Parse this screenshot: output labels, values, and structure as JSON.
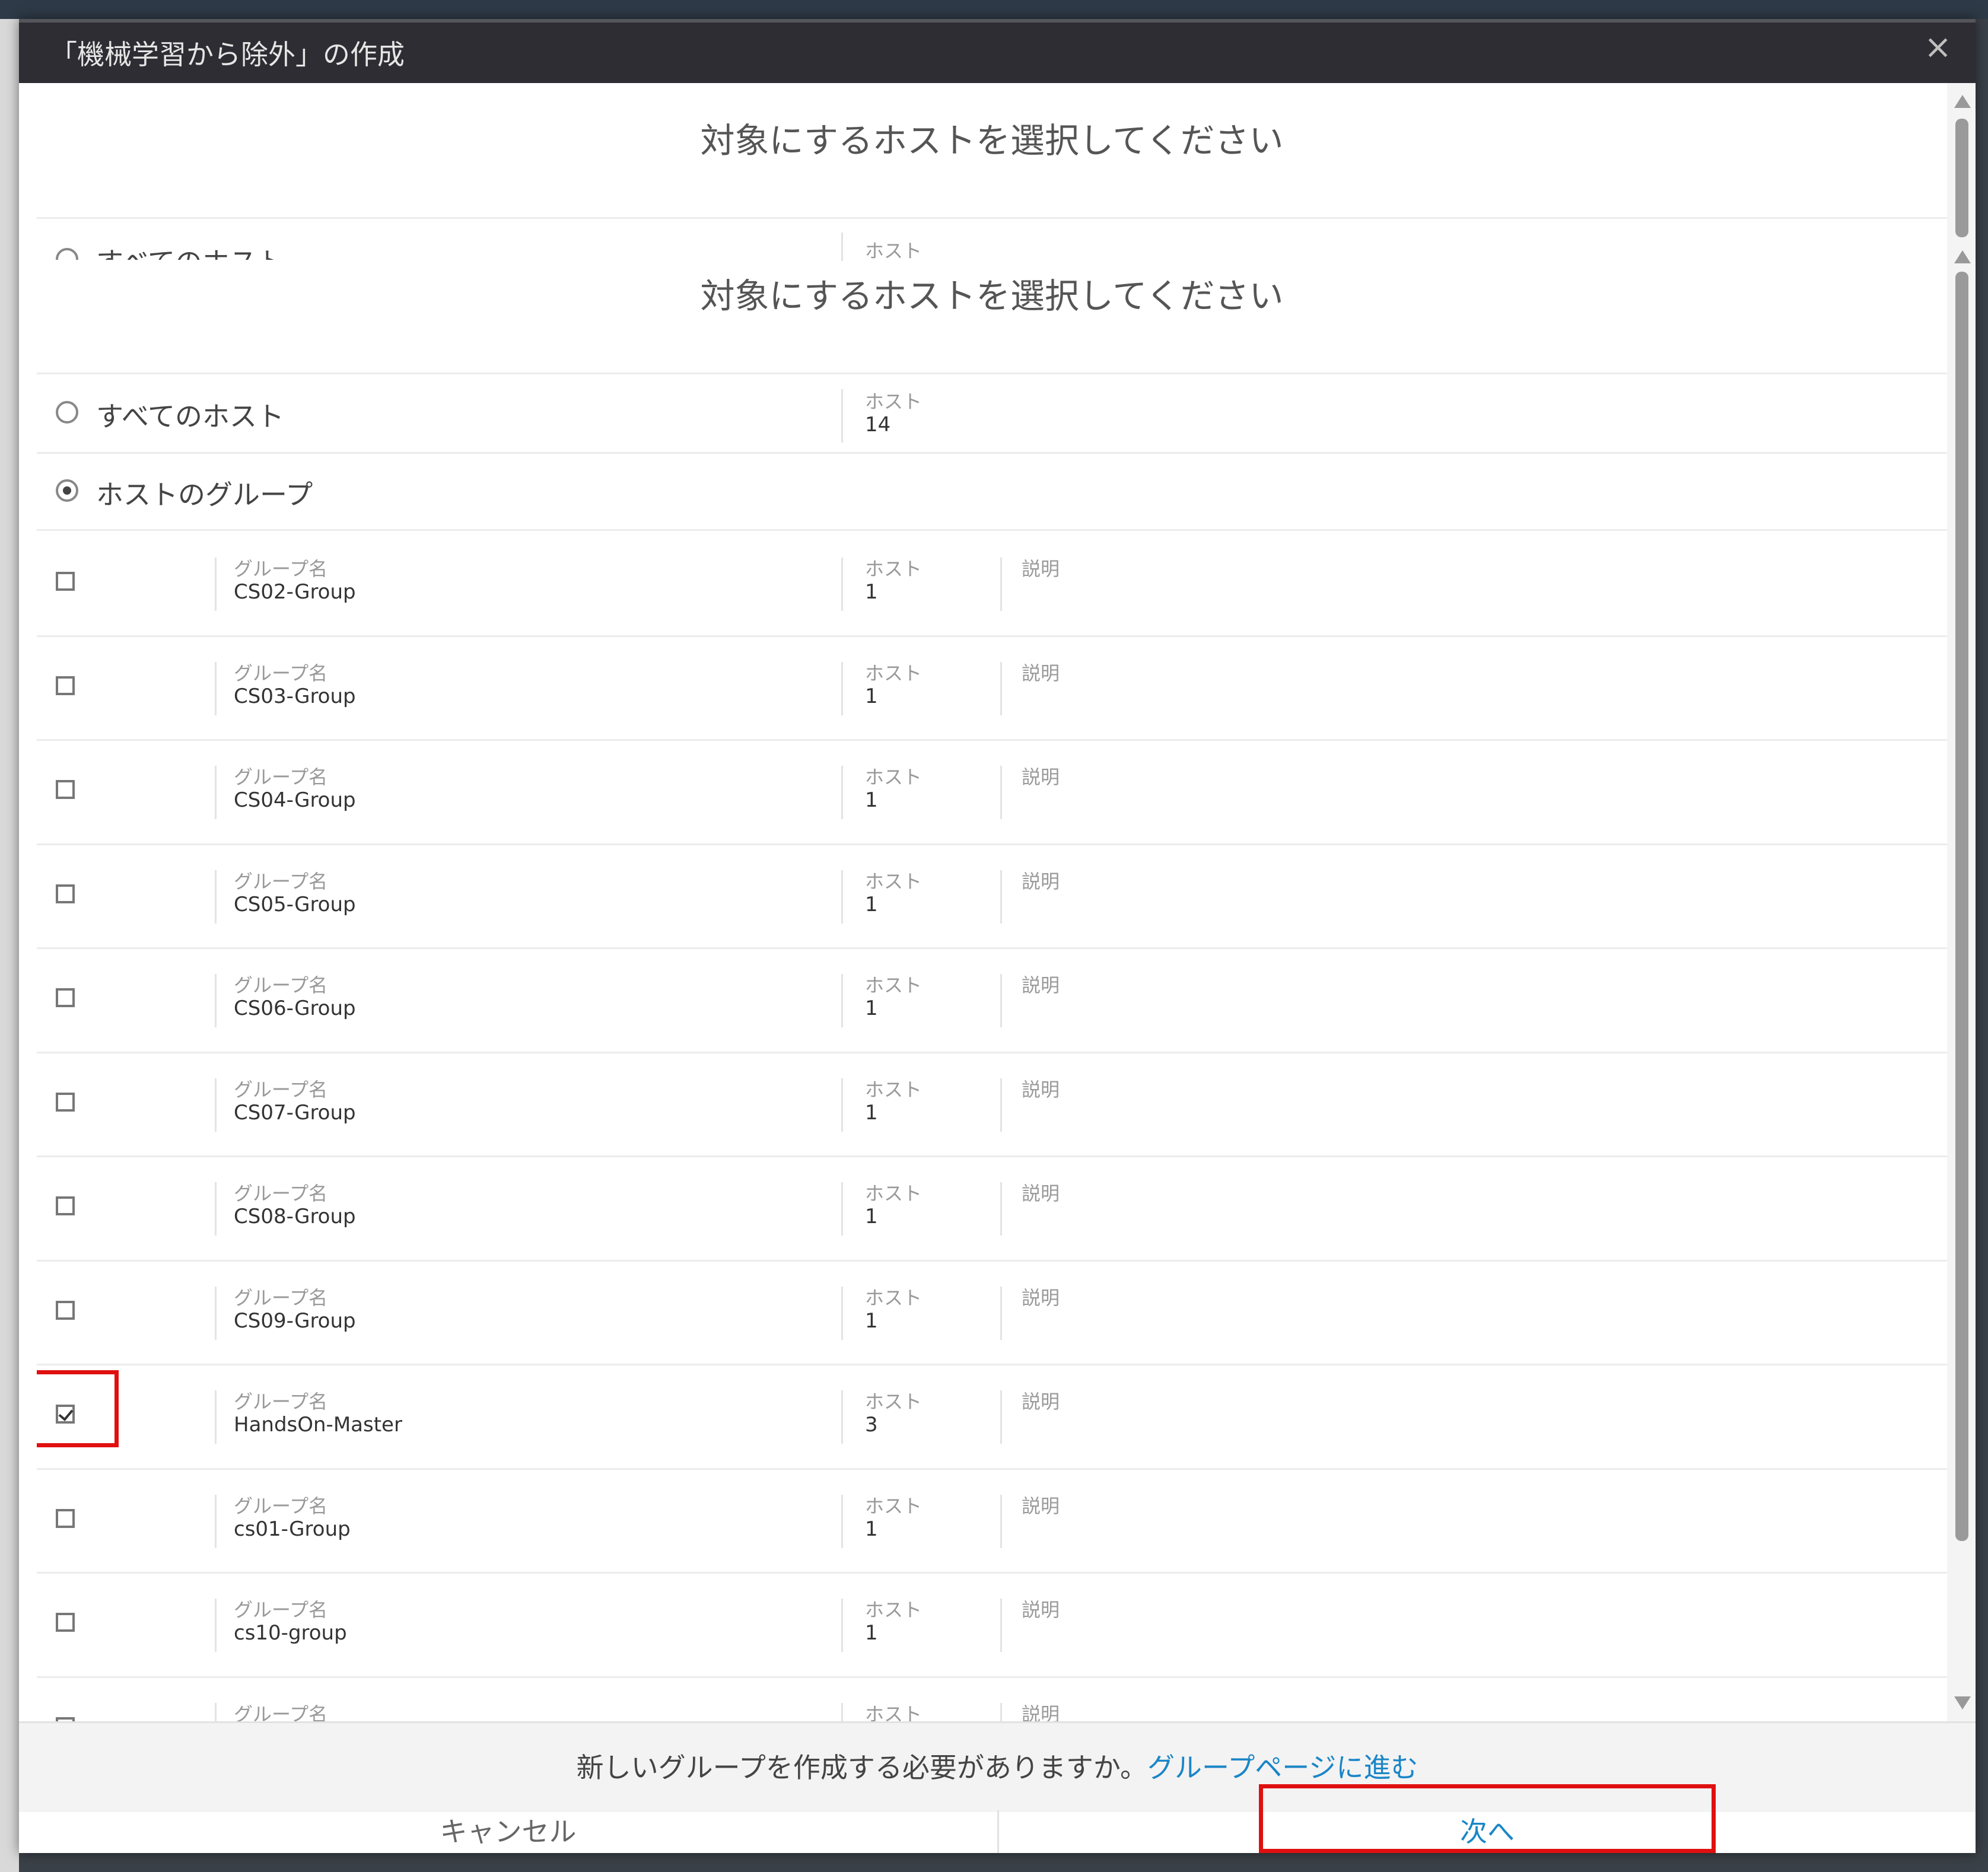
{
  "dialog": {
    "title": "「機械学習から除外」の作成",
    "close": "×"
  },
  "heading": "対象にするホストを選択してください",
  "ghost_option": "すべてのホスト",
  "options": {
    "all_hosts": {
      "label": "すべてのホスト",
      "host_label": "ホスト",
      "host_count": "14"
    },
    "host_group": {
      "label": "ホストのグループ"
    }
  },
  "columns": {
    "group_name": "グループ名",
    "hosts": "ホスト",
    "description": "説明"
  },
  "groups": [
    {
      "name": "CS02-Group",
      "hosts": "1",
      "checked": false
    },
    {
      "name": "CS03-Group",
      "hosts": "1",
      "checked": false
    },
    {
      "name": "CS04-Group",
      "hosts": "1",
      "checked": false
    },
    {
      "name": "CS05-Group",
      "hosts": "1",
      "checked": false
    },
    {
      "name": "CS06-Group",
      "hosts": "1",
      "checked": false
    },
    {
      "name": "CS07-Group",
      "hosts": "1",
      "checked": false
    },
    {
      "name": "CS08-Group",
      "hosts": "1",
      "checked": false
    },
    {
      "name": "CS09-Group",
      "hosts": "1",
      "checked": false
    },
    {
      "name": "HandsOn-Master",
      "hosts": "3",
      "checked": true
    },
    {
      "name": "cs01-Group",
      "hosts": "1",
      "checked": false
    },
    {
      "name": "cs10-group",
      "hosts": "1",
      "checked": false
    },
    {
      "name": "",
      "hosts": "",
      "checked": false
    }
  ],
  "footer": {
    "question": "新しいグループを作成する必要がありますか。",
    "link": "グループページに進む"
  },
  "buttons": {
    "cancel": "キャンセル",
    "next": "次へ"
  },
  "colors": {
    "accent": "#1a86c7",
    "highlight": "#e01010",
    "titlebar": "#2d2d33"
  }
}
